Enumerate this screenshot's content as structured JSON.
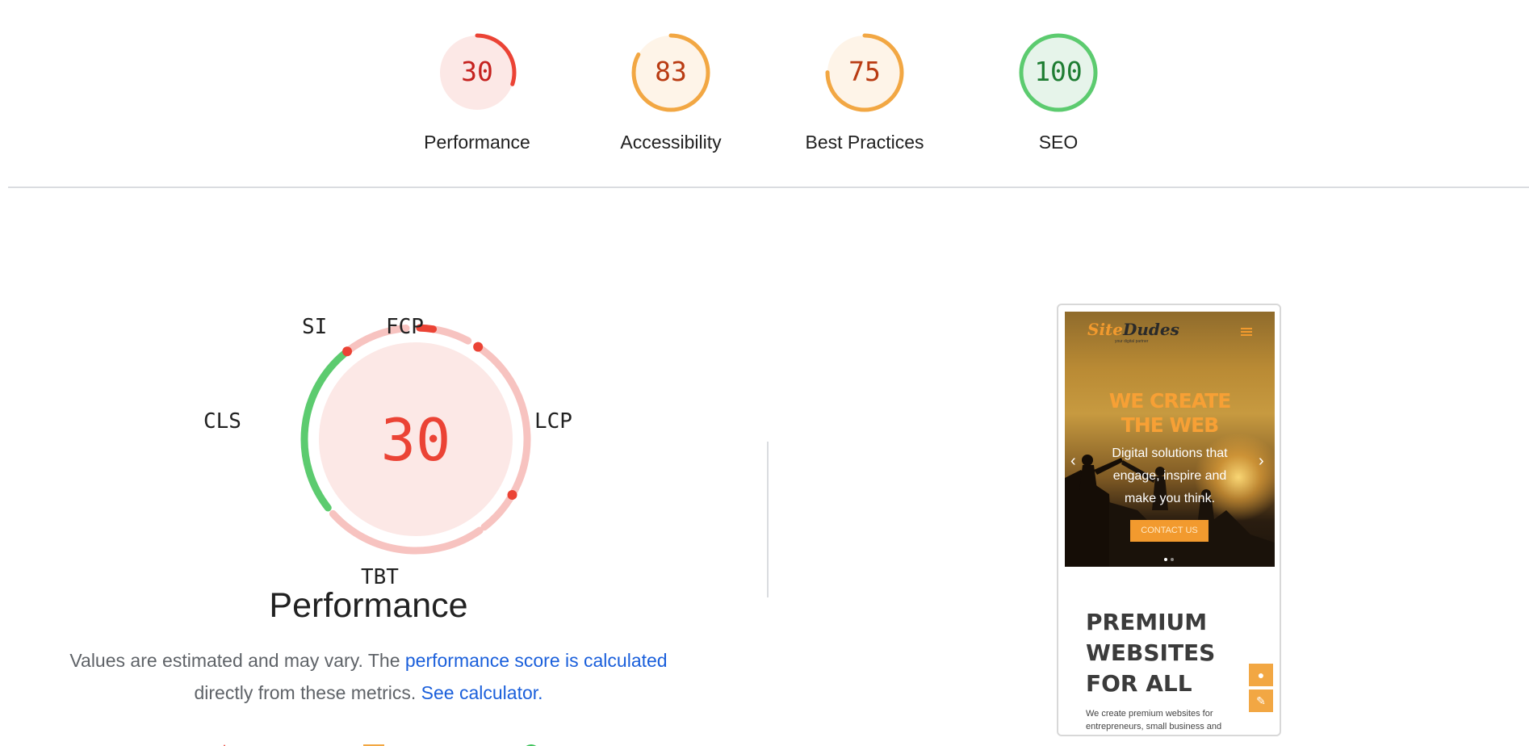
{
  "categories": [
    {
      "score": "30",
      "label": "Performance",
      "fraction": 0.3,
      "status": "fail",
      "color": "#eb4335",
      "track": "#fce8e6",
      "text_color": "#c5221f"
    },
    {
      "score": "83",
      "label": "Accessibility",
      "fraction": 0.83,
      "status": "average",
      "color": "#f2a743",
      "track": "#fef4e8",
      "text_color": "#b93b12"
    },
    {
      "score": "75",
      "label": "Best Practices",
      "fraction": 0.75,
      "status": "average",
      "color": "#f2a743",
      "track": "#fef4e8",
      "text_color": "#b93b12"
    },
    {
      "score": "100",
      "label": "SEO",
      "fraction": 1.0,
      "status": "pass",
      "color": "#5ccb6f",
      "track": "#e6f4ea",
      "text_color": "#1e7d32"
    }
  ],
  "performance": {
    "score": "30",
    "title": "Performance",
    "metrics": {
      "si": "SI",
      "fcp": "FCP",
      "lcp": "LCP",
      "tbt": "TBT",
      "cls": "CLS"
    },
    "desc_prefix": "Values are estimated and may vary. The ",
    "calc_link": "performance score is calculated",
    "desc_middle": "directly from these metrics.",
    "calculator_link": "See calculator."
  },
  "screenshot": {
    "logo_part1": "Site",
    "logo_part2": "Dudes",
    "logo_tagline": "your digital partner",
    "hero_heading_line1": "WE CREATE",
    "hero_heading_line2": "THE WEB",
    "hero_sub": "Digital solutions that engage, inspire and make you think.",
    "hero_button": "CONTACT US",
    "premium_heading": "PREMIUM WEBSITES FOR ALL",
    "premium_sub": "We create premium websites for entrepreneurs, small business and"
  },
  "colors": {
    "fail": "#eb4335",
    "average": "#f2a743",
    "pass": "#5ccb6f",
    "link": "#1a5fdb",
    "divider": "#dadce0"
  }
}
